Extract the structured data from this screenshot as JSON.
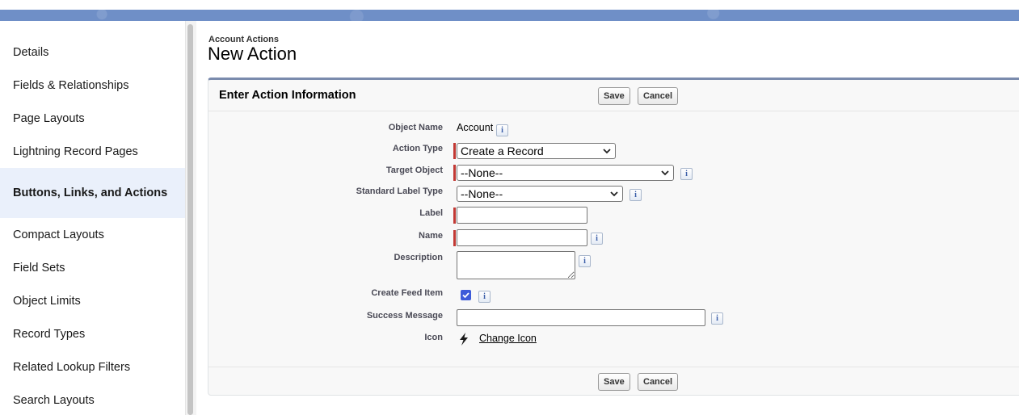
{
  "sidebar": {
    "items": [
      {
        "label": "Details"
      },
      {
        "label": "Fields & Relationships"
      },
      {
        "label": "Page Layouts"
      },
      {
        "label": "Lightning Record Pages"
      },
      {
        "label": "Buttons, Links, and Actions",
        "active": true
      },
      {
        "label": "Compact Layouts"
      },
      {
        "label": "Field Sets"
      },
      {
        "label": "Object Limits"
      },
      {
        "label": "Record Types"
      },
      {
        "label": "Related Lookup Filters"
      },
      {
        "label": "Search Layouts"
      }
    ]
  },
  "page": {
    "breadcrumb": "Account Actions",
    "title": "New Action"
  },
  "panel": {
    "title": "Enter Action Information",
    "save_label": "Save",
    "cancel_label": "Cancel"
  },
  "form": {
    "object_name": {
      "label": "Object Name",
      "value": "Account"
    },
    "action_type": {
      "label": "Action Type",
      "value": "Create a Record"
    },
    "target_object": {
      "label": "Target Object",
      "value": "--None--"
    },
    "standard_label_type": {
      "label": "Standard Label Type",
      "value": "--None--"
    },
    "label": {
      "label": "Label",
      "value": ""
    },
    "name": {
      "label": "Name",
      "value": ""
    },
    "description": {
      "label": "Description",
      "value": ""
    },
    "create_feed_item": {
      "label": "Create Feed Item",
      "checked": true
    },
    "success_message": {
      "label": "Success Message",
      "value": ""
    },
    "icon": {
      "label": "Icon",
      "icon_name": "lightning-bolt-icon",
      "link": "Change Icon"
    }
  },
  "info_glyph": "i",
  "colors": {
    "banner": "#6f8fc7",
    "required": "#c23934",
    "checkbox": "#3d5bd9",
    "active_nav": "#eaf0fb"
  }
}
